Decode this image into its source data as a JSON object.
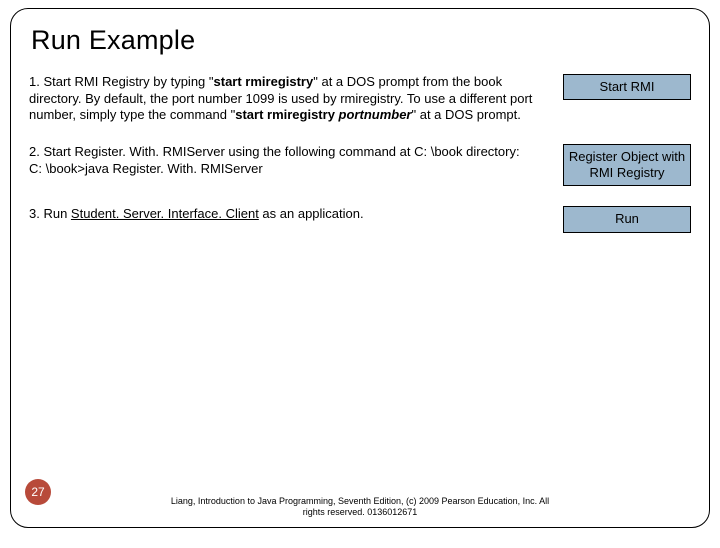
{
  "slide": {
    "title": "Run Example",
    "steps": [
      {
        "prefix": "1. Start RMI Registry by typing \"",
        "bold1": "start rmiregistry",
        "mid": "\" at a DOS prompt from the book directory. By default, the port number 1099 is used by rmiregistry. To use a different port number, simply type the command \"",
        "bold2a": "start rmiregistry ",
        "bold2b_italic": "portnumber",
        "suffix": "\" at a DOS prompt.",
        "button": "Start RMI"
      },
      {
        "text": "2. Start Register. With. RMIServer using the following command at C: \\book directory:\nC: \\book>java Register. With. RMIServer",
        "button": "Register Object with RMI Registry"
      },
      {
        "prefix": "3. Run ",
        "underlined": "Student. Server. Interface. Client",
        "suffix": " as an application.",
        "button": "Run"
      }
    ],
    "page_number": "27",
    "footer_line1": "Liang, Introduction to Java Programming, Seventh Edition, (c) 2009 Pearson Education, Inc. All",
    "footer_line2": "rights reserved. 0136012671"
  }
}
